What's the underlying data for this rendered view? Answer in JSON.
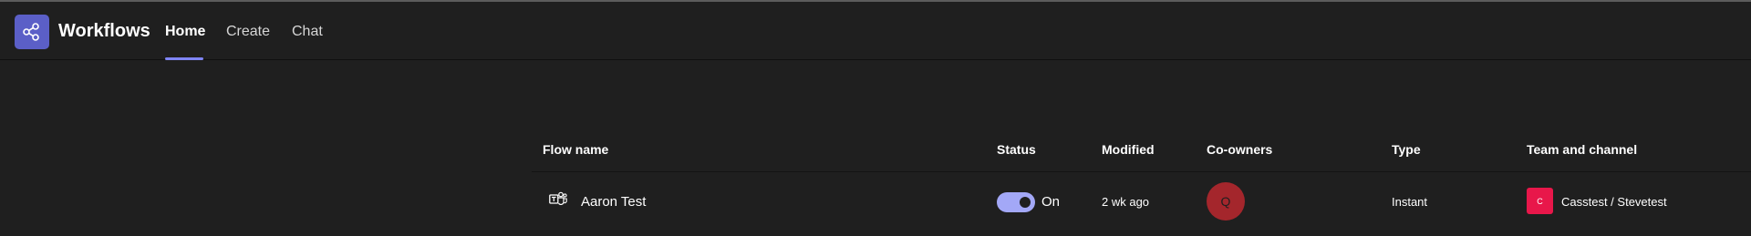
{
  "app": {
    "title": "Workflows",
    "icon": "workflows-share-icon",
    "accent": "#5b5fc7"
  },
  "tabs": [
    {
      "label": "Home",
      "active": true
    },
    {
      "label": "Create",
      "active": false
    },
    {
      "label": "Chat",
      "active": false
    }
  ],
  "table": {
    "headers": {
      "flow_name": "Flow name",
      "status": "Status",
      "modified": "Modified",
      "co_owners": "Co-owners",
      "type": "Type",
      "team_channel": "Team and channel"
    },
    "rows": [
      {
        "flow_icon": "teams-icon",
        "flow_name": "Aaron Test",
        "status_on": true,
        "status_label": "On",
        "modified": "2 wk ago",
        "co_owner_initial": "Q",
        "co_owner_color": "#a4262c",
        "type": "Instant",
        "team_badge_letter": "C",
        "team_badge_color": "#e8174a",
        "team_channel": "Casstest / Stevetest"
      }
    ]
  }
}
